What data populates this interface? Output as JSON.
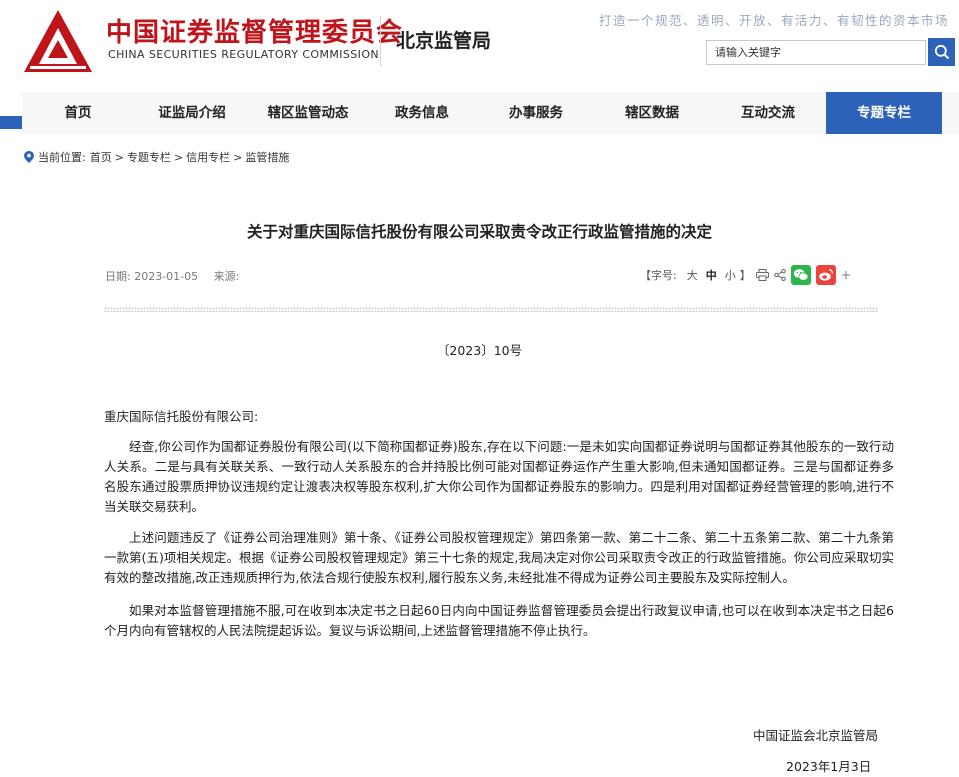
{
  "header": {
    "org_name_cn": "中国证券监督管理委员会",
    "org_name_en": "CHINA SECURITIES REGULATORY COMMISSION",
    "bureau": "北京监管局",
    "slogan": "打造一个规范、透明、开放、有活力、有韧性的资本市场",
    "search_placeholder": "请输入关键字",
    "brand_red": "#c0141b",
    "accent_blue": "#2c62b8"
  },
  "nav": {
    "items": [
      {
        "label": "首页",
        "active": false
      },
      {
        "label": "证监局介绍",
        "active": false
      },
      {
        "label": "辖区监管动态",
        "active": false
      },
      {
        "label": "政务信息",
        "active": false
      },
      {
        "label": "办事服务",
        "active": false
      },
      {
        "label": "辖区数据",
        "active": false
      },
      {
        "label": "互动交流",
        "active": false
      },
      {
        "label": "专题专栏",
        "active": true
      }
    ]
  },
  "breadcrumb": {
    "prefix": "当前位置:",
    "items": [
      "首页",
      "专题专栏",
      "信用专栏",
      "监管措施"
    ],
    "separator": ">"
  },
  "article": {
    "title": "关于对重庆国际信托股份有限公司采取责令改正行政监管措施的决定",
    "date_label": "日期:",
    "date": "2023-01-05",
    "source_label": "来源:",
    "font_label_open": "【字号:",
    "font_large": "大",
    "font_medium": "中",
    "font_small": "小",
    "font_label_close": "】",
    "doc_number": "〔2023〕10号",
    "addressee": "重庆国际信托股份有限公司:",
    "paragraphs": [
      "经查,你公司作为国都证券股份有限公司(以下简称国都证券)股东,存在以下问题:一是未如实向国都证券说明与国都证券其他股东的一致行动人关系。二是与具有关联关系、一致行动人关系股东的合并持股比例可能对国都证券运作产生重大影响,但未通知国都证券。三是与国都证券多名股东通过股票质押协议违规约定让渡表决权等股东权利,扩大你公司作为国都证券股东的影响力。四是利用对国都证券经营管理的影响,进行不当关联交易获利。",
      "上述问题违反了《证券公司治理准则》第十条、《证券公司股权管理规定》第四条第一款、第二十二条、第二十五条第二款、第二十九条第一款第(五)项相关规定。根据《证券公司股权管理规定》第三十七条的规定,我局决定对你公司采取责令改正的行政监管措施。你公司应采取切实有效的整改措施,改正违规质押行为,依法合规行使股东权利,履行股东义务,未经批准不得成为证券公司主要股东及实际控制人。",
      "如果对本监督管理措施不服,可在收到本决定书之日起60日内向中国证券监督管理委员会提出行政复议申请,也可以在收到本决定书之日起6个月内向有管辖权的人民法院提起诉讼。复议与诉讼期间,上述监督管理措施不停止执行。"
    ],
    "signature_org": "中国证监会北京监管局",
    "signature_date": "2023年1月3日"
  },
  "icons": {
    "location": "location-pin-icon",
    "search": "search-icon",
    "print": "print-icon",
    "share": "share-icon",
    "wechat": "wechat-icon",
    "weibo": "weibo-icon",
    "more": "plus-icon"
  }
}
